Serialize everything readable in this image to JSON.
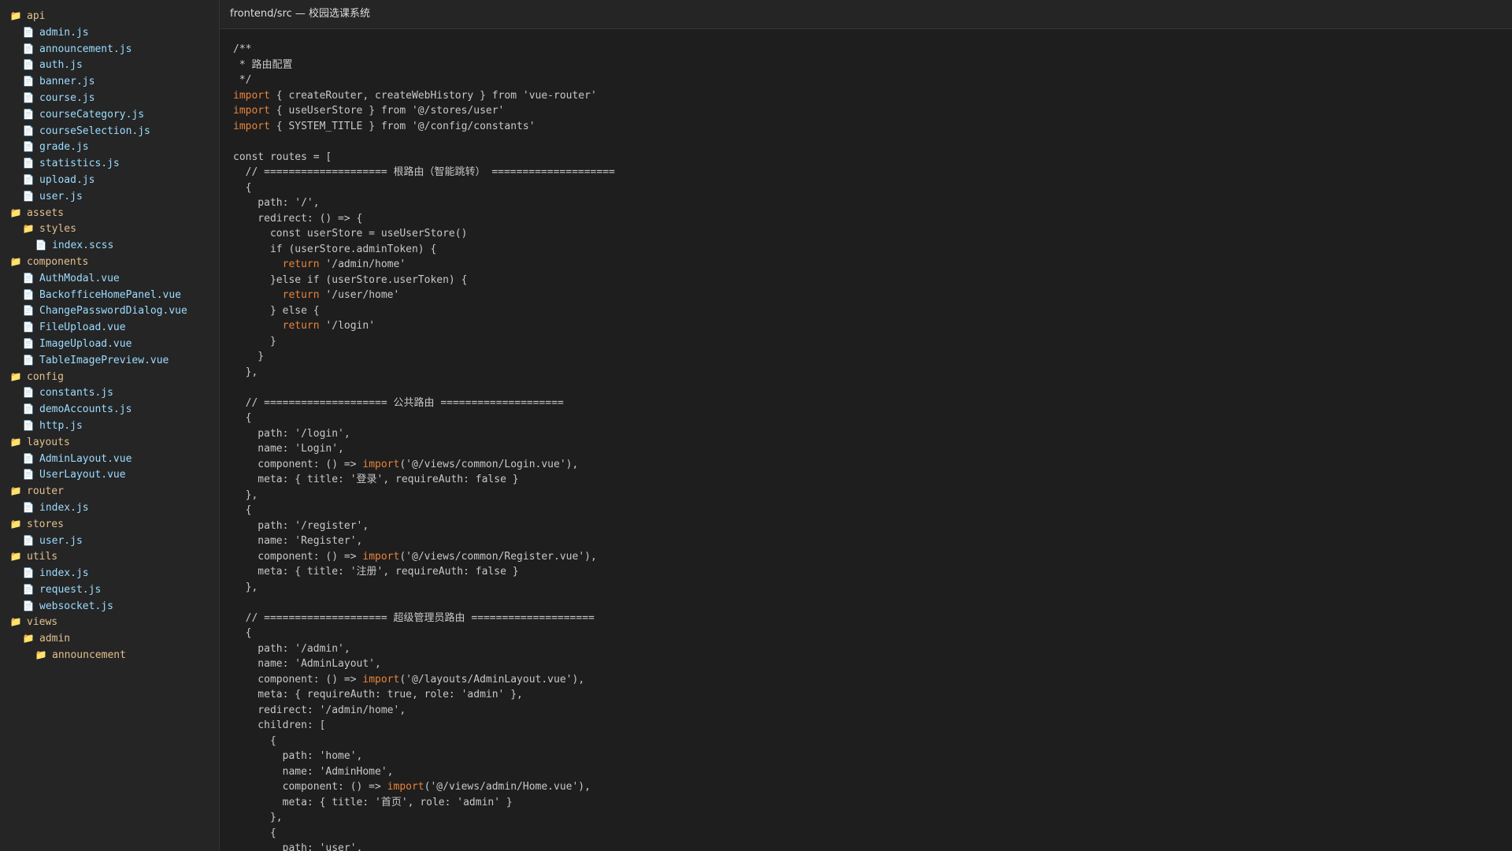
{
  "window": {
    "title": "frontend/src — 校园选课系统"
  },
  "colors": {
    "folder": "#e2c08d",
    "file": "#9cdcfe",
    "keyword": "#e8833a",
    "code": "#c8c8c8",
    "sidebar_bg": "#252526",
    "editor_bg": "#1e1e1e"
  },
  "icons": {
    "folder": "folder-icon",
    "file": "file-icon"
  },
  "file_tree": [
    {
      "type": "folder",
      "depth": 0,
      "label": "api"
    },
    {
      "type": "file",
      "depth": 1,
      "label": "admin.js"
    },
    {
      "type": "file",
      "depth": 1,
      "label": "announcement.js"
    },
    {
      "type": "file",
      "depth": 1,
      "label": "auth.js"
    },
    {
      "type": "file",
      "depth": 1,
      "label": "banner.js"
    },
    {
      "type": "file",
      "depth": 1,
      "label": "course.js"
    },
    {
      "type": "file",
      "depth": 1,
      "label": "courseCategory.js"
    },
    {
      "type": "file",
      "depth": 1,
      "label": "courseSelection.js"
    },
    {
      "type": "file",
      "depth": 1,
      "label": "grade.js"
    },
    {
      "type": "file",
      "depth": 1,
      "label": "statistics.js"
    },
    {
      "type": "file",
      "depth": 1,
      "label": "upload.js"
    },
    {
      "type": "file",
      "depth": 1,
      "label": "user.js"
    },
    {
      "type": "folder",
      "depth": 0,
      "label": "assets"
    },
    {
      "type": "folder",
      "depth": 1,
      "label": "styles"
    },
    {
      "type": "file",
      "depth": 2,
      "label": "index.scss"
    },
    {
      "type": "folder",
      "depth": 0,
      "label": "components"
    },
    {
      "type": "file",
      "depth": 1,
      "label": "AuthModal.vue"
    },
    {
      "type": "file",
      "depth": 1,
      "label": "BackofficeHomePanel.vue"
    },
    {
      "type": "file",
      "depth": 1,
      "label": "ChangePasswordDialog.vue"
    },
    {
      "type": "file",
      "depth": 1,
      "label": "FileUpload.vue"
    },
    {
      "type": "file",
      "depth": 1,
      "label": "ImageUpload.vue"
    },
    {
      "type": "file",
      "depth": 1,
      "label": "TableImagePreview.vue"
    },
    {
      "type": "folder",
      "depth": 0,
      "label": "config"
    },
    {
      "type": "file",
      "depth": 1,
      "label": "constants.js"
    },
    {
      "type": "file",
      "depth": 1,
      "label": "demoAccounts.js"
    },
    {
      "type": "file",
      "depth": 1,
      "label": "http.js"
    },
    {
      "type": "folder",
      "depth": 0,
      "label": "layouts"
    },
    {
      "type": "file",
      "depth": 1,
      "label": "AdminLayout.vue"
    },
    {
      "type": "file",
      "depth": 1,
      "label": "UserLayout.vue"
    },
    {
      "type": "folder",
      "depth": 0,
      "label": "router"
    },
    {
      "type": "file",
      "depth": 1,
      "label": "index.js"
    },
    {
      "type": "folder",
      "depth": 0,
      "label": "stores"
    },
    {
      "type": "file",
      "depth": 1,
      "label": "user.js"
    },
    {
      "type": "folder",
      "depth": 0,
      "label": "utils"
    },
    {
      "type": "file",
      "depth": 1,
      "label": "index.js"
    },
    {
      "type": "file",
      "depth": 1,
      "label": "request.js"
    },
    {
      "type": "file",
      "depth": 1,
      "label": "websocket.js"
    },
    {
      "type": "folder",
      "depth": 0,
      "label": "views"
    },
    {
      "type": "folder",
      "depth": 1,
      "label": "admin"
    },
    {
      "type": "folder",
      "depth": 2,
      "label": "announcement"
    }
  ],
  "code_lines": [
    "/**",
    " * 路由配置",
    " */",
    "import { createRouter, createWebHistory } from 'vue-router'",
    "import { useUserStore } from '@/stores/user'",
    "import { SYSTEM_TITLE } from '@/config/constants'",
    "",
    "const routes = [",
    "  // ==================== 根路由（智能跳转） ====================",
    "  {",
    "    path: '/',",
    "    redirect: () => {",
    "      const userStore = useUserStore()",
    "      if (userStore.adminToken) {",
    "        return '/admin/home'",
    "      }else if (userStore.userToken) {",
    "        return '/user/home'",
    "      } else {",
    "        return '/login'",
    "      }",
    "    }",
    "  },",
    "",
    "  // ==================== 公共路由 ====================",
    "  {",
    "    path: '/login',",
    "    name: 'Login',",
    "    component: () => import('@/views/common/Login.vue'),",
    "    meta: { title: '登录', requireAuth: false }",
    "  },",
    "  {",
    "    path: '/register',",
    "    name: 'Register',",
    "    component: () => import('@/views/common/Register.vue'),",
    "    meta: { title: '注册', requireAuth: false }",
    "  },",
    "",
    "  // ==================== 超级管理员路由 ====================",
    "  {",
    "    path: '/admin',",
    "    name: 'AdminLayout',",
    "    component: () => import('@/layouts/AdminLayout.vue'),",
    "    meta: { requireAuth: true, role: 'admin' },",
    "    redirect: '/admin/home',",
    "    children: [",
    "      {",
    "        path: 'home',",
    "        name: 'AdminHome',",
    "        component: () => import('@/views/admin/Home.vue'),",
    "        meta: { title: '首页', role: 'admin' }",
    "      },",
    "      {",
    "        path: 'user',"
  ]
}
